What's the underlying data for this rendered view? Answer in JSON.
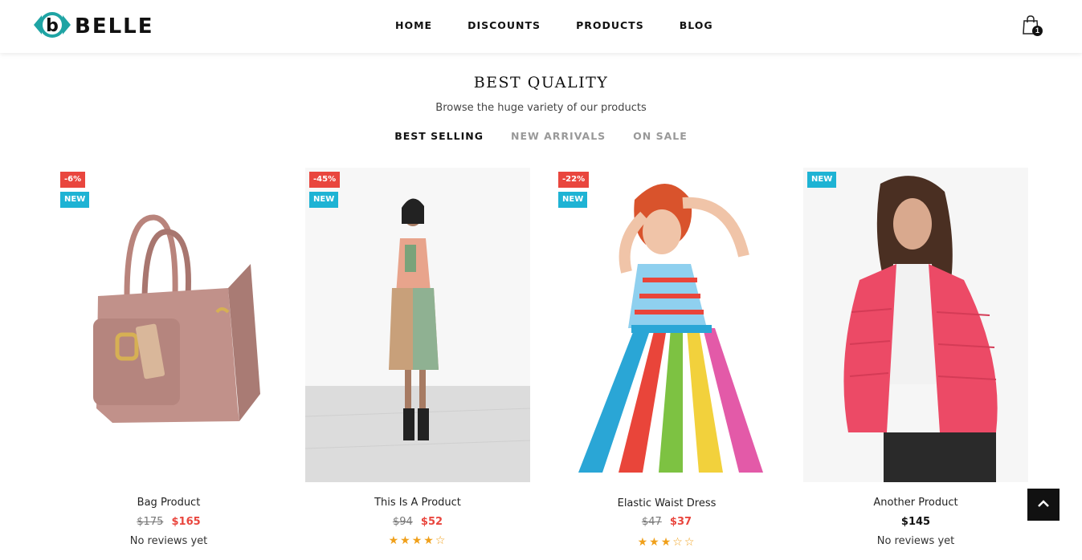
{
  "brand": {
    "name": "BELLE",
    "logo_letter": "b",
    "accent": "#1fa4a4"
  },
  "nav": [
    {
      "label": "HOME"
    },
    {
      "label": "DISCOUNTS"
    },
    {
      "label": "PRODUCTS"
    },
    {
      "label": "BLOG"
    }
  ],
  "cart": {
    "count": "1",
    "icon": "shopping-bag-icon"
  },
  "section": {
    "title": "BEST QUALITY",
    "subtitle": "Browse the huge variety of our products",
    "tabs": [
      {
        "label": "BEST SELLING",
        "active": true
      },
      {
        "label": "NEW ARRIVALS",
        "active": false
      },
      {
        "label": "ON SALE",
        "active": false
      }
    ]
  },
  "products": [
    {
      "name": "Bag Product",
      "discount": "-6%",
      "new_label": "NEW",
      "old_price": "$175",
      "price": "$165",
      "reviews": "No reviews yet",
      "rating": null
    },
    {
      "name": "This Is A Product",
      "discount": "-45%",
      "new_label": "NEW",
      "old_price": "$94",
      "price": "$52",
      "reviews": null,
      "rating": 4
    },
    {
      "name": "Elastic Waist Dress",
      "discount": "-22%",
      "new_label": "NEW",
      "old_price": "$47",
      "price": "$37",
      "reviews": null,
      "rating": 3
    },
    {
      "name": "Another Product",
      "discount": null,
      "new_label": "NEW",
      "old_price": null,
      "price": "$145",
      "reviews": "No reviews yet",
      "rating": null
    }
  ],
  "colors": {
    "sale_badge": "#e9463e",
    "new_badge": "#1eb3d4",
    "sale_price": "#e9463e",
    "star": "#f0a01b"
  },
  "back_to_top": {
    "icon": "chevron-up-icon"
  }
}
